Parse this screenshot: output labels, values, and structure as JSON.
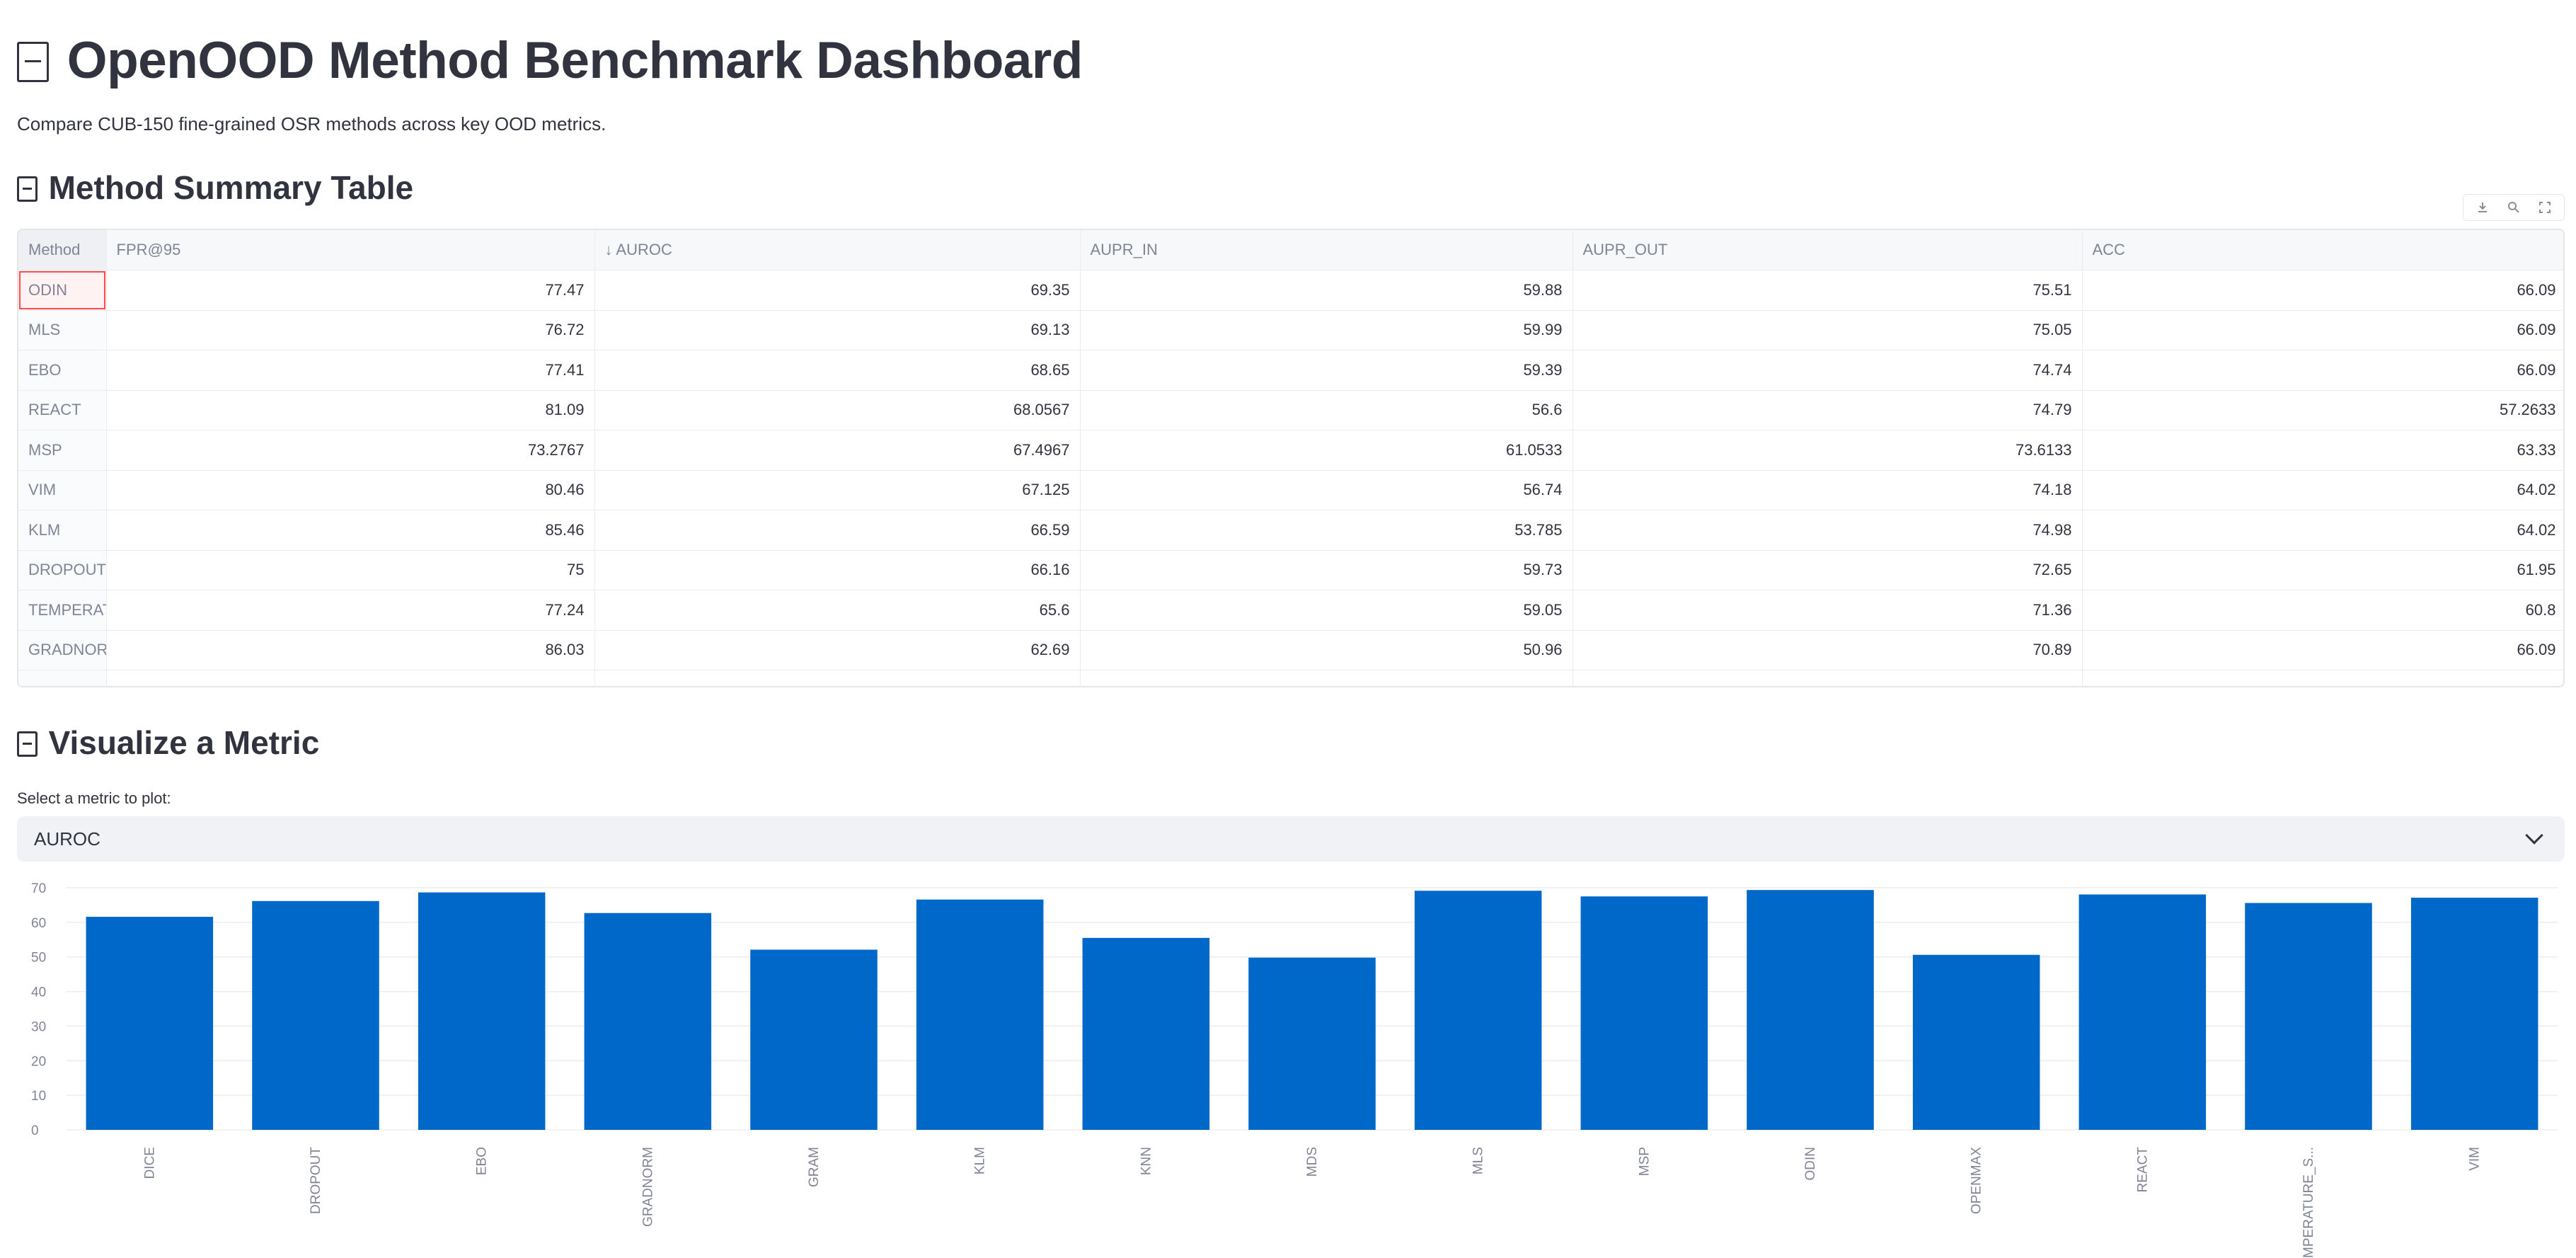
{
  "header": {
    "title": "OpenOOD Method Benchmark Dashboard",
    "subtitle": "Compare CUB-150 fine-grained OSR methods across key OOD metrics."
  },
  "summary": {
    "heading": "Method Summary Table",
    "toolbar": [
      "download-icon",
      "search-icon",
      "fullscreen-icon"
    ],
    "columns": [
      "Method",
      "FPR@95",
      "↓ AUROC",
      "AUPR_IN",
      "AUPR_OUT",
      "ACC"
    ],
    "rows": [
      [
        "ODIN",
        "77.47",
        "69.35",
        "59.88",
        "75.51",
        "66.09"
      ],
      [
        "MLS",
        "76.72",
        "69.13",
        "59.99",
        "75.05",
        "66.09"
      ],
      [
        "EBO",
        "77.41",
        "68.65",
        "59.39",
        "74.74",
        "66.09"
      ],
      [
        "REACT",
        "81.09",
        "68.0567",
        "56.6",
        "74.79",
        "57.2633"
      ],
      [
        "MSP",
        "73.2767",
        "67.4967",
        "61.0533",
        "73.6133",
        "63.33"
      ],
      [
        "VIM",
        "80.46",
        "67.125",
        "56.74",
        "74.18",
        "64.02"
      ],
      [
        "KLM",
        "85.46",
        "66.59",
        "53.785",
        "74.98",
        "64.02"
      ],
      [
        "DROPOUT",
        "75",
        "66.16",
        "59.73",
        "72.65",
        "61.95"
      ],
      [
        "TEMPERATU",
        "77.24",
        "65.6",
        "59.05",
        "71.36",
        "60.8"
      ],
      [
        "GRADNORM",
        "86.03",
        "62.69",
        "50.96",
        "70.89",
        "66.09"
      ]
    ],
    "selected_row": 0
  },
  "visualize": {
    "heading": "Visualize a Metric",
    "select_label": "Select a metric to plot:",
    "selected_metric": "AUROC"
  },
  "colors": {
    "bar": "#0068c9",
    "accent": "#ff4b4b"
  },
  "chart_data": {
    "type": "bar",
    "categories": [
      "DICE",
      "DROPOUT",
      "EBO",
      "GRADNORM",
      "GRAM",
      "KLM",
      "KNN",
      "MDS",
      "MLS",
      "MSP",
      "ODIN",
      "OPENMAX",
      "REACT",
      "TEMPERATURE_S...",
      "VIM"
    ],
    "values": [
      61.6,
      66.16,
      68.65,
      62.69,
      52.1,
      66.59,
      55.5,
      49.8,
      69.13,
      67.4967,
      69.35,
      50.6,
      68.0567,
      65.6,
      67.125
    ],
    "yticks": [
      0,
      10,
      20,
      30,
      40,
      50,
      60,
      70
    ],
    "ylim": [
      0,
      70
    ],
    "grid": true
  }
}
